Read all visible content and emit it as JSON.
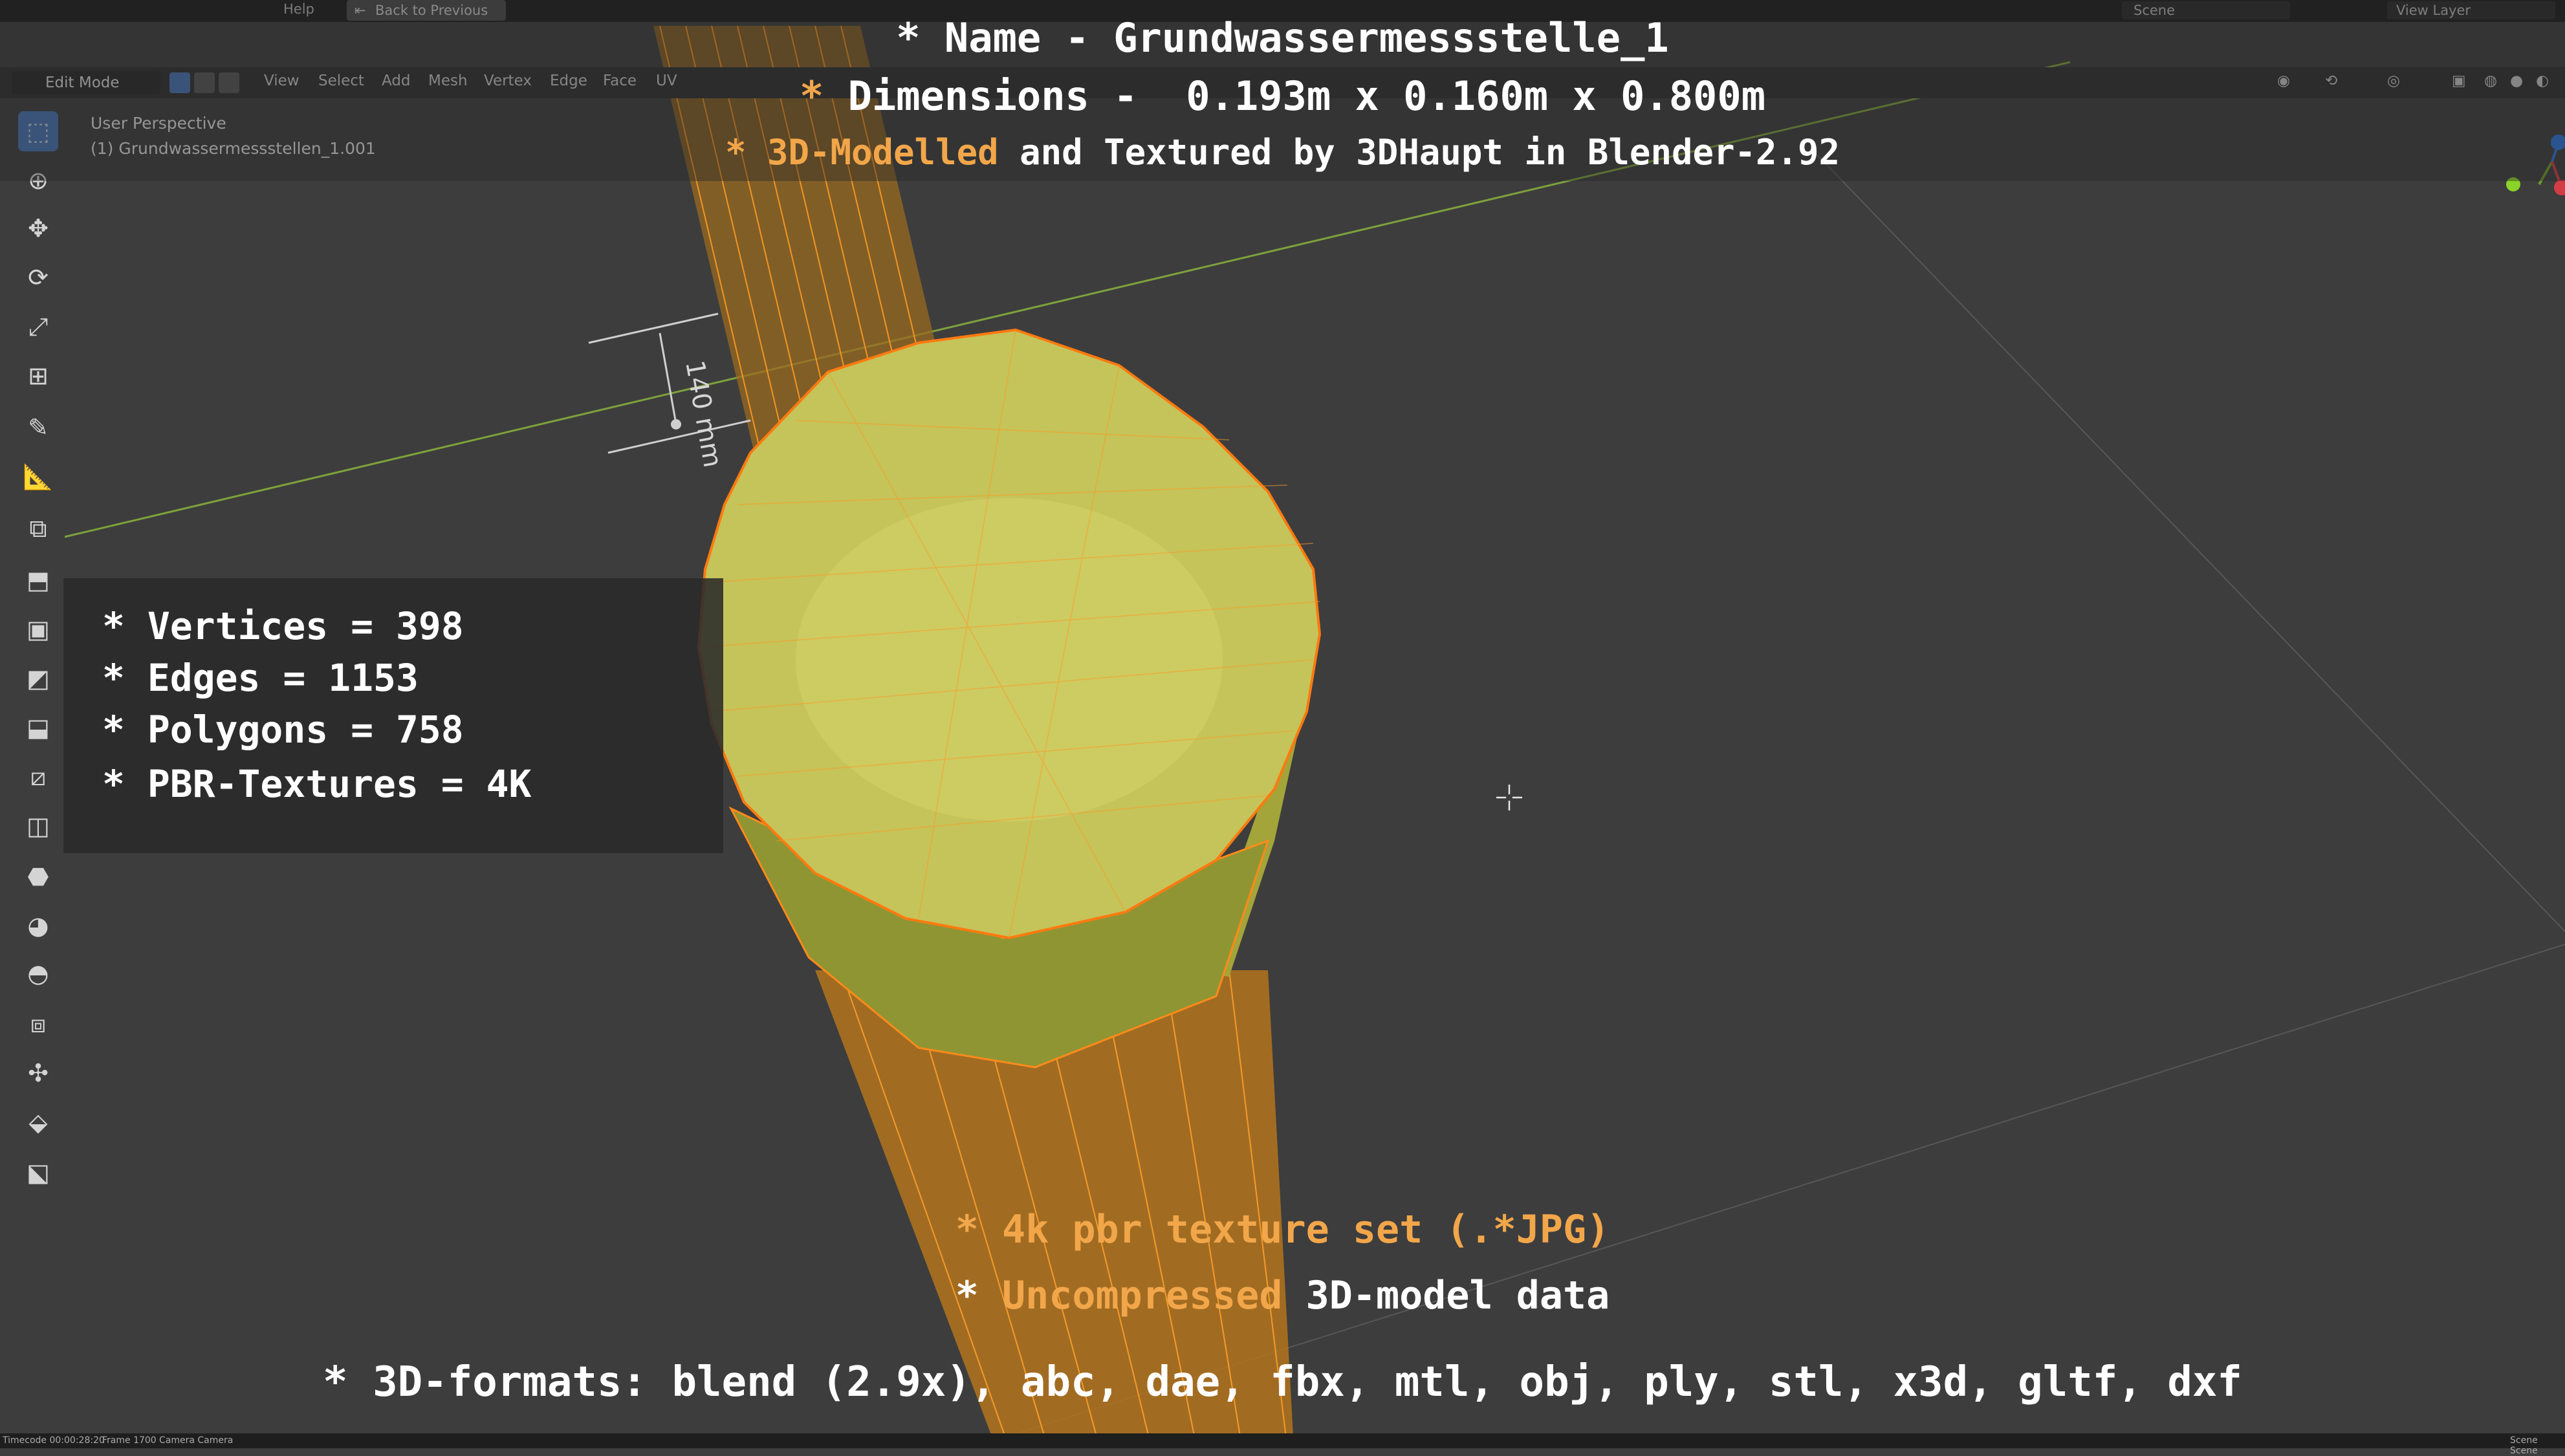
{
  "menu": {
    "help": "Help",
    "back_to_previous": "Back to Previous",
    "scene": "Scene",
    "view_layer": "View Layer"
  },
  "header": {
    "mode": "Edit Mode",
    "menus": [
      "View",
      "Select",
      "Add",
      "Mesh",
      "Vertex",
      "Edge",
      "Face",
      "UV"
    ]
  },
  "viewport": {
    "perspective": "User Perspective",
    "object": "(1) Grundwassermessstellen_1.001",
    "dimension_label": "140 mm"
  },
  "overlay": {
    "name_line": "* Name - Grundwassermessstelle_1",
    "dim_prefix": "* ",
    "dim_rest": "Dimensions -  0.193m x 0.160m x 0.800m",
    "credit_prefix": "* ",
    "credit_highlight": "3D-Modelled",
    "credit_rest": " and Textured by 3DHaupt in Blender-2.92",
    "stats": [
      "* Vertices = 398",
      "* Edges = 1153",
      "* Polygons = 758",
      "* PBR-Textures = 4K"
    ],
    "texture_prefix": "* ",
    "texture_highlight": "4k pbr texture set (.*JPG)",
    "uncompressed_prefix": "* ",
    "uncompressed_highlight": "Uncompressed",
    "uncompressed_rest": " 3D-model data",
    "formats_line": "* 3D-formats: blend (2.9x), abc, dae, fbx, mtl, obj, ply, stl, x3d, gltf, dxf"
  },
  "status": {
    "timecode": "Timecode 00:00:28:20",
    "frame": "Frame 1700",
    "camera": "Camera Camera",
    "scene_right": "Scene Scene"
  },
  "colors": {
    "mesh_fill": "#b4bb4a",
    "wire": "#ff8c1a",
    "selection_blue": "#4772b3",
    "highlight_text": "#f2a64a"
  },
  "icons": {
    "toolbar": [
      "select-box",
      "cursor",
      "move",
      "rotate",
      "scale",
      "transform",
      "annotate",
      "measure",
      "add-cube",
      "extrude",
      "inset",
      "bevel",
      "loop-cut",
      "knife",
      "poly-build",
      "spin",
      "smooth",
      "edge-slide",
      "shrink-fatten",
      "shear",
      "rip"
    ]
  }
}
